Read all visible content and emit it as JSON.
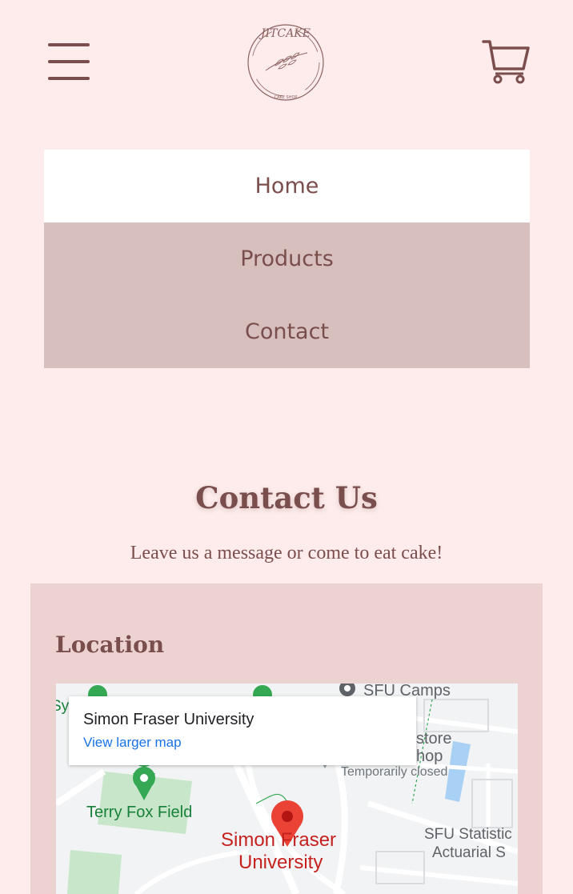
{
  "header": {
    "menu_icon": "hamburger-menu-icon",
    "logo_icon": "jitcake-logo",
    "logo_text": "JITCAKE",
    "logo_subtext": "CAKE SHOP",
    "cart_icon": "shopping-cart-icon"
  },
  "nav": {
    "items": [
      {
        "label": "Home",
        "active": true
      },
      {
        "label": "Products"
      },
      {
        "label": "Contact"
      }
    ]
  },
  "contact": {
    "title": "Contact Us",
    "subtitle": "Leave us a message or come to eat cake!"
  },
  "location": {
    "title": "Location",
    "map": {
      "place_name": "Simon Fraser University",
      "view_larger": "View larger map",
      "labels": {
        "sfu_camps": "SFU Camps",
        "store": "store",
        "hop": "hop",
        "temporarily_closed": "Temporarily closed",
        "terry_fox": "Terry Fox Field",
        "sfu_main_line1": "Simon Fraser",
        "sfu_main_line2": "University",
        "sfu_stat_line1": "SFU Statistic",
        "sfu_stat_line2": "Actuarial S",
        "edge_sy": "Sy"
      }
    }
  },
  "colors": {
    "background": "#fdeceb",
    "text": "#7a4e4c",
    "menu_alt": "#d6bfbd",
    "card": "#ecd3d1",
    "map_pin": "#ea4335",
    "map_green": "#34a853"
  }
}
